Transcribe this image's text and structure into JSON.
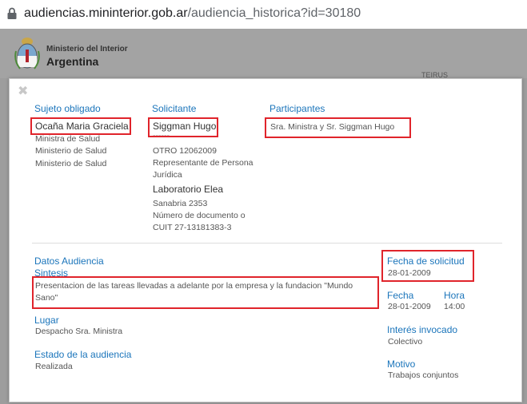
{
  "browser": {
    "url_domain": "audiencias.mininterior.gob.ar",
    "url_path": "/audiencia_historica?id=30180"
  },
  "site": {
    "org": "Ministerio del Interior",
    "country": "Argentina",
    "faint_text": "TEIRUS"
  },
  "modal": {
    "close": "✖",
    "sujeto": {
      "header": "Sujeto obligado",
      "name": "Ocaña Maria Graciela",
      "lines": [
        "Ministra de Salud",
        "Ministerio de Salud",
        "Ministerio de Salud"
      ]
    },
    "solicitante": {
      "header": "Solicitante",
      "name": "Siggman Hugo",
      "dashes": "------",
      "lines": [
        "OTRO 12062009",
        "Representante de Persona",
        "Jurídica"
      ],
      "company": "Laboratorio Elea",
      "lines2": [
        "Sanabria 2353",
        "Número de documento o",
        "CUIT 27-13181383-3"
      ]
    },
    "participantes": {
      "header": "Participantes",
      "value": "Sra. Ministra y Sr. Siggman Hugo"
    },
    "datos": {
      "header": "Datos Audiencia",
      "sintesis_label": "Sintesis",
      "sintesis_line1": "Presentacion de las tareas llevadas a adelante por la empresa y la fundacion \"Mundo",
      "sintesis_line2": "Sano\"",
      "lugar_label": "Lugar",
      "lugar_value": "Despacho Sra. Ministra",
      "estado_label": "Estado de la audiencia",
      "estado_value": "Realizada"
    },
    "right": {
      "fecha_solicitud_label": "Fecha de solicitud",
      "fecha_solicitud_value": "28-01-2009",
      "fecha_label": "Fecha",
      "fecha_value": "28-01-2009",
      "hora_label": "Hora",
      "hora_value": "14:00",
      "interes_label": "Interés invocado",
      "interes_value": "Colectivo",
      "motivo_label": "Motivo",
      "motivo_value": "Trabajos conjuntos"
    }
  },
  "colors": {
    "link_blue": "#1b75bb",
    "highlight_red": "#e0242b",
    "overlay_gray": "#a3a3a3"
  }
}
